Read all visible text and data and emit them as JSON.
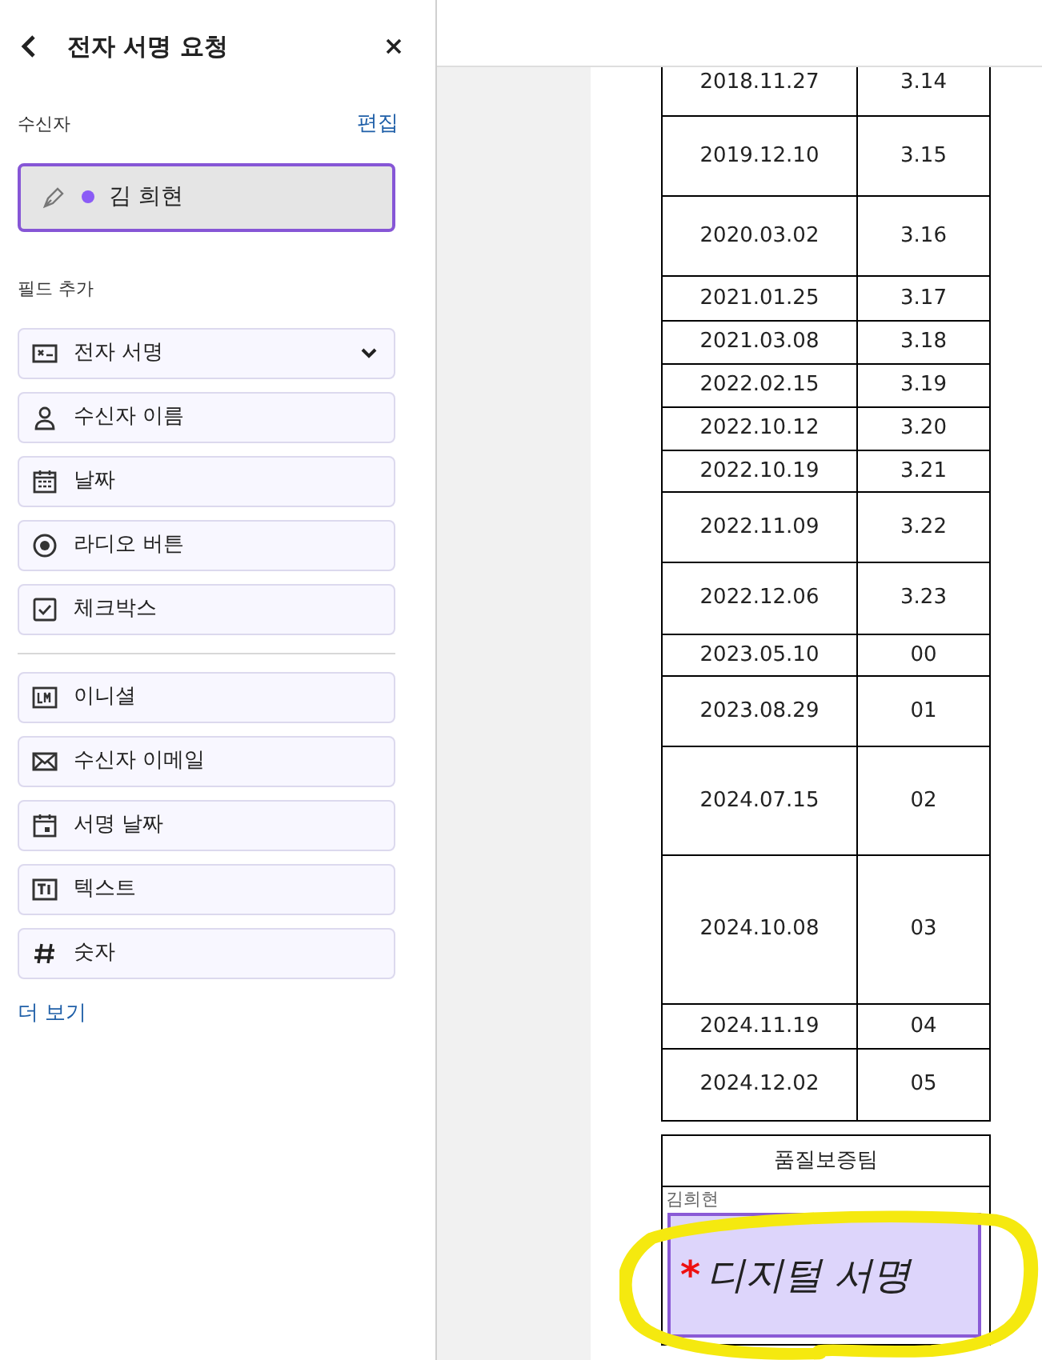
{
  "panel": {
    "title": "전자 서명 요청",
    "recipients_label": "수신자",
    "edit_link": "편집",
    "recipient": {
      "name": "김 희현",
      "color": "#8b5cf6",
      "selected": true
    },
    "fields_label": "필드 추가",
    "field_groups": [
      [
        {
          "kind": "signature",
          "label": "전자 서명",
          "expandable": true
        },
        {
          "kind": "person",
          "label": "수신자 이름"
        },
        {
          "kind": "calendar",
          "label": "날짜"
        },
        {
          "kind": "radio",
          "label": "라디오 버튼"
        },
        {
          "kind": "checkbox",
          "label": "체크박스"
        }
      ],
      [
        {
          "kind": "initials",
          "label": "이니셜"
        },
        {
          "kind": "mail",
          "label": "수신자 이메일"
        },
        {
          "kind": "signdate",
          "label": "서명 날짜"
        },
        {
          "kind": "text",
          "label": "텍스트"
        },
        {
          "kind": "number",
          "label": "숫자"
        }
      ]
    ],
    "more_link": "더 보기"
  },
  "document": {
    "rows": [
      {
        "date": "2018.11.27",
        "rev": "3.14"
      },
      {
        "date": "2019.12.10",
        "rev": "3.15"
      },
      {
        "date": "2020.03.02",
        "rev": "3.16"
      },
      {
        "date": "2021.01.25",
        "rev": "3.17"
      },
      {
        "date": "2021.03.08",
        "rev": "3.18"
      },
      {
        "date": "2022.02.15",
        "rev": "3.19"
      },
      {
        "date": "2022.10.12",
        "rev": "3.20"
      },
      {
        "date": "2022.10.19",
        "rev": "3.21"
      },
      {
        "date": "2022.11.09",
        "rev": "3.22"
      },
      {
        "date": "2022.12.06",
        "rev": "3.23"
      },
      {
        "date": "2023.05.10",
        "rev": "00"
      },
      {
        "date": "2023.08.29",
        "rev": "01"
      },
      {
        "date": "2024.07.15",
        "rev": "02"
      },
      {
        "date": "2024.10.08",
        "rev": "03"
      },
      {
        "date": "2024.11.19",
        "rev": "04"
      },
      {
        "date": "2024.12.02",
        "rev": "05"
      }
    ],
    "approval": {
      "team": "품질보증팀",
      "signer": "김희현",
      "field": {
        "required_mark": "*",
        "label": "디지털 서명"
      }
    }
  }
}
